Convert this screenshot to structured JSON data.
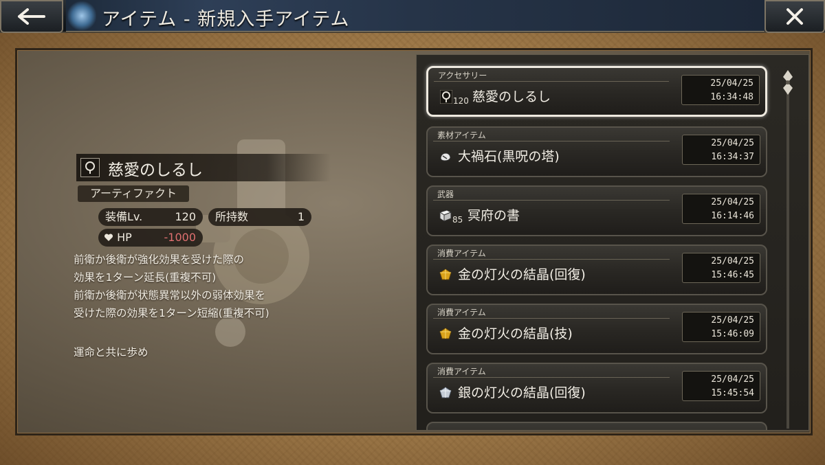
{
  "header": {
    "title": "アイテム - 新規入手アイテム",
    "back_icon": "arrow-left-icon",
    "close_icon": "close-icon"
  },
  "detail": {
    "name": "慈愛のしるし",
    "icon": "ring-icon",
    "category": "アーティファクト",
    "equip_level_label": "装備Lv.",
    "equip_level": "120",
    "owned_label": "所持数",
    "owned": "1",
    "hp_label": "HP",
    "hp_value": "-1000",
    "description": [
      "前衛か後衛が強化効果を受けた際の",
      "効果を1ターン延長(重複不可)",
      "前衛か後衛が状態異常以外の弱体効果を",
      "受けた際の効果を1ターン短縮(重複不可)"
    ],
    "flavor": "運命と共に歩め"
  },
  "items": [
    {
      "category": "アクセサリー",
      "icon": "ring-icon",
      "level": "120",
      "name": "慈愛のしるし",
      "date": "25/04/25",
      "time": "16:34:48",
      "selected": true
    },
    {
      "category": "素材アイテム",
      "icon": "stone-icon",
      "level": "",
      "name": "大禍石(黒呪の塔)",
      "date": "25/04/25",
      "time": "16:34:37",
      "selected": false
    },
    {
      "category": "武器",
      "icon": "book-icon",
      "level": "85",
      "name": "冥府の書",
      "date": "25/04/25",
      "time": "16:14:46",
      "selected": false
    },
    {
      "category": "消費アイテム",
      "icon": "gold-crystal-icon",
      "level": "",
      "name": "金の灯火の結晶(回復)",
      "date": "25/04/25",
      "time": "15:46:45",
      "selected": false
    },
    {
      "category": "消費アイテム",
      "icon": "gold-crystal-icon",
      "level": "",
      "name": "金の灯火の結晶(技)",
      "date": "25/04/25",
      "time": "15:46:09",
      "selected": false
    },
    {
      "category": "消費アイテム",
      "icon": "silver-crystal-icon",
      "level": "",
      "name": "銀の灯火の結晶(回復)",
      "date": "25/04/25",
      "time": "15:45:54",
      "selected": false
    }
  ],
  "colors": {
    "hp_value": "#e07070",
    "gold_crystal": "#d9a21b",
    "silver_crystal": "#c5ccd6"
  }
}
